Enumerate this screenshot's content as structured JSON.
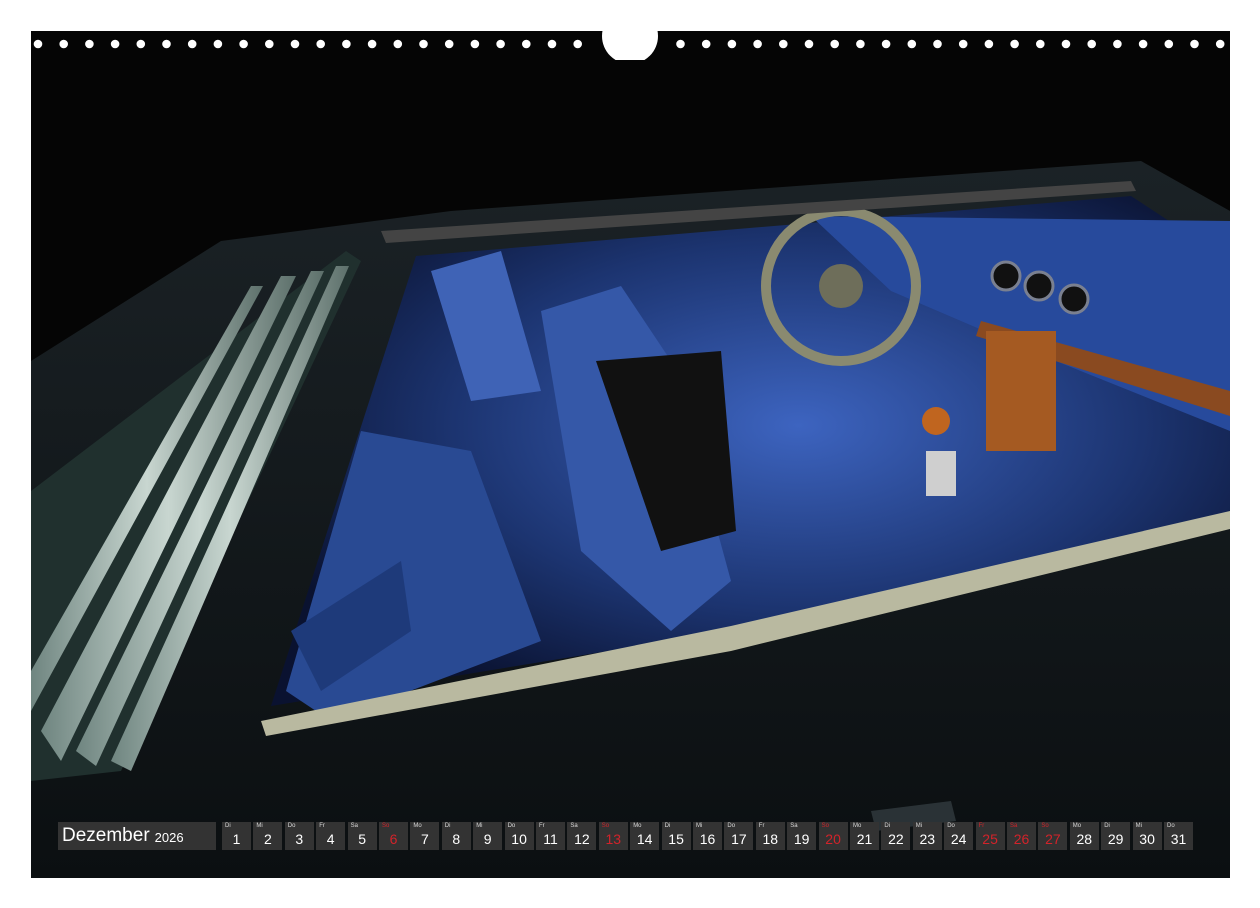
{
  "calendar": {
    "month": "Dezember",
    "year": "2026",
    "days": [
      {
        "wd": "Di",
        "n": "1"
      },
      {
        "wd": "Mi",
        "n": "2"
      },
      {
        "wd": "Do",
        "n": "3"
      },
      {
        "wd": "Fr",
        "n": "4"
      },
      {
        "wd": "Sa",
        "n": "5"
      },
      {
        "wd": "So",
        "n": "6",
        "red": true
      },
      {
        "wd": "Mo",
        "n": "7"
      },
      {
        "wd": "Di",
        "n": "8"
      },
      {
        "wd": "Mi",
        "n": "9"
      },
      {
        "wd": "Do",
        "n": "10"
      },
      {
        "wd": "Fr",
        "n": "11"
      },
      {
        "wd": "Sa",
        "n": "12"
      },
      {
        "wd": "So",
        "n": "13",
        "red": true
      },
      {
        "wd": "Mo",
        "n": "14"
      },
      {
        "wd": "Di",
        "n": "15"
      },
      {
        "wd": "Mi",
        "n": "16"
      },
      {
        "wd": "Do",
        "n": "17"
      },
      {
        "wd": "Fr",
        "n": "18"
      },
      {
        "wd": "Sa",
        "n": "19"
      },
      {
        "wd": "So",
        "n": "20",
        "red": true
      },
      {
        "wd": "Mo",
        "n": "21"
      },
      {
        "wd": "Di",
        "n": "22"
      },
      {
        "wd": "Mi",
        "n": "23"
      },
      {
        "wd": "Do",
        "n": "24"
      },
      {
        "wd": "Fr",
        "n": "25",
        "red": true
      },
      {
        "wd": "Sa",
        "n": "26",
        "red": true
      },
      {
        "wd": "So",
        "n": "27",
        "red": true
      },
      {
        "wd": "Mo",
        "n": "28"
      },
      {
        "wd": "Di",
        "n": "29"
      },
      {
        "wd": "Mi",
        "n": "30"
      },
      {
        "wd": "Do",
        "n": "31"
      }
    ]
  },
  "colors": {
    "cell_bg": "#333333",
    "holiday_red": "#d2232a",
    "interior_blue": "#2f55a8"
  },
  "photo": {
    "subject_icon": "car-interior-photo"
  }
}
